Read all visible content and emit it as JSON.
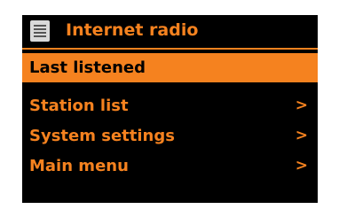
{
  "header": {
    "icon": "list-icon",
    "title": "Internet radio"
  },
  "menu": {
    "items": [
      {
        "label": "Last listened",
        "arrow": "",
        "selected": true
      },
      {
        "label": "Station list",
        "arrow": ">",
        "selected": false
      },
      {
        "label": "System settings",
        "arrow": ">",
        "selected": false
      },
      {
        "label": "Main menu",
        "arrow": ">",
        "selected": false
      }
    ]
  },
  "colors": {
    "accent": "#f5821f",
    "background": "#000000",
    "selected_text": "#000000"
  }
}
